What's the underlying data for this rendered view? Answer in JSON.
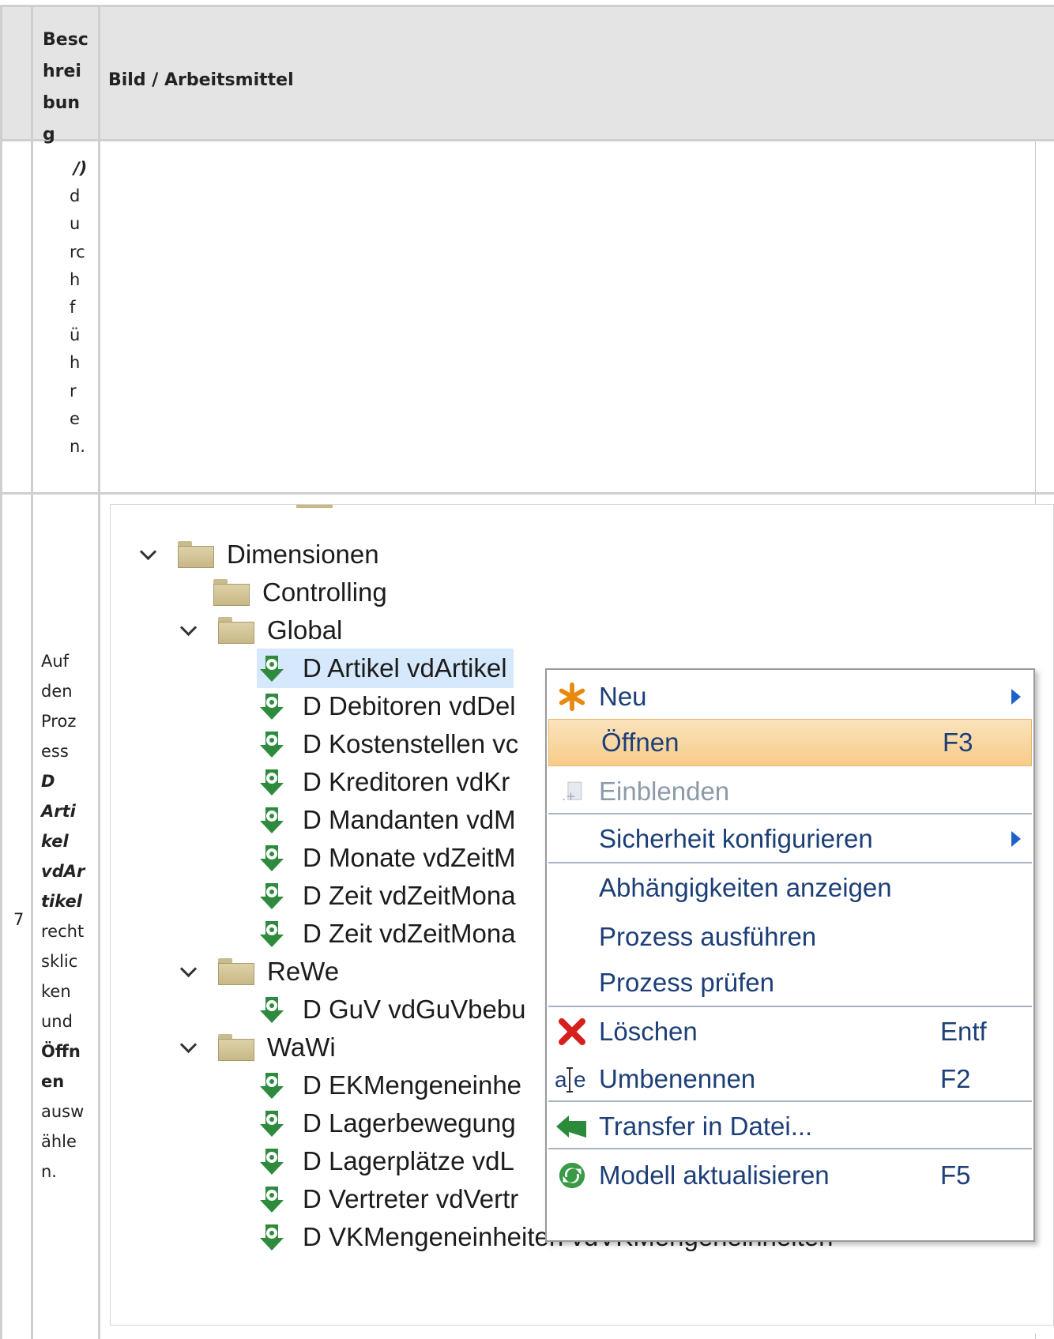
{
  "table": {
    "header": {
      "col_desc": [
        "Besc",
        "hrei",
        "bun",
        "g"
      ],
      "col_bild": "Bild / Arbeitsmittel"
    },
    "row_prev": {
      "desc_chars": [
        "/)",
        "d",
        "u",
        "rc",
        "h",
        "f",
        "ü",
        "h",
        "r",
        "e",
        "n."
      ]
    },
    "row7": {
      "number": "7",
      "desc_lines": [
        {
          "t": "Auf",
          "s": "n"
        },
        {
          "t": "den",
          "s": "n"
        },
        {
          "t": "Proz",
          "s": "n"
        },
        {
          "t": "ess",
          "s": "n"
        },
        {
          "t": "D",
          "s": "bi"
        },
        {
          "t": "Arti",
          "s": "bi"
        },
        {
          "t": "kel",
          "s": "bi"
        },
        {
          "t": "vdAr",
          "s": "bi"
        },
        {
          "t": "tikel",
          "s": "bi"
        },
        {
          "t": "recht",
          "s": "n"
        },
        {
          "t": "sklic",
          "s": "n"
        },
        {
          "t": "ken",
          "s": "n"
        },
        {
          "t": "und",
          "s": "n"
        },
        {
          "t": "Öffn",
          "s": "b"
        },
        {
          "t": "en",
          "s": "b"
        },
        {
          "t": "ausw",
          "s": "n"
        },
        {
          "t": "ähle",
          "s": "n"
        },
        {
          "t": "n.",
          "s": "n"
        }
      ]
    }
  },
  "tree": {
    "items": [
      {
        "label": "Dimensionen",
        "kind": "folder",
        "expanded": true
      },
      {
        "label": "Controlling",
        "kind": "folder",
        "expanded": false
      },
      {
        "label": "Global",
        "kind": "folder",
        "expanded": true
      },
      {
        "label": "D Artikel vdArtikel",
        "kind": "process",
        "selected": true
      },
      {
        "label": "D Debitoren vdDel",
        "kind": "process"
      },
      {
        "label": "D Kostenstellen vc",
        "kind": "process"
      },
      {
        "label": "D Kreditoren vdKr",
        "kind": "process"
      },
      {
        "label": "D Mandanten vdM",
        "kind": "process"
      },
      {
        "label": "D Monate vdZeitM",
        "kind": "process"
      },
      {
        "label": "D Zeit vdZeitMona",
        "kind": "process"
      },
      {
        "label": "D Zeit vdZeitMona",
        "kind": "process"
      },
      {
        "label": "ReWe",
        "kind": "folder",
        "expanded": true
      },
      {
        "label": "D GuV vdGuVbebu",
        "kind": "process"
      },
      {
        "label": "WaWi",
        "kind": "folder",
        "expanded": true
      },
      {
        "label": "D EKMengeneinhe",
        "kind": "process"
      },
      {
        "label": "D Lagerbewegung",
        "kind": "process"
      },
      {
        "label": "D Lagerplätze vdL",
        "kind": "process"
      },
      {
        "label": "D Vertreter vdVertr",
        "kind": "process"
      },
      {
        "label": "D VKMengeneinheiten vdVKMengeneinheiten",
        "kind": "process"
      }
    ]
  },
  "context_menu": {
    "items": [
      {
        "label": "Neu",
        "shortcut": "",
        "icon": "asterisk-icon",
        "submenu": true
      },
      {
        "label": "Öffnen",
        "shortcut": "F3",
        "icon": "",
        "highlighted": true
      },
      {
        "label": "Einblenden",
        "shortcut": "",
        "icon": "show-icon",
        "disabled": true
      },
      {
        "label": "Sicherheit konfigurieren",
        "shortcut": "",
        "icon": "",
        "submenu": true
      },
      {
        "label": "Abhängigkeiten anzeigen",
        "shortcut": "",
        "icon": ""
      },
      {
        "label": "Prozess ausführen",
        "shortcut": "",
        "icon": ""
      },
      {
        "label": "Prozess prüfen",
        "shortcut": "",
        "icon": ""
      },
      {
        "label": "Löschen",
        "shortcut": "Entf",
        "icon": "delete-x-icon"
      },
      {
        "label": "Umbenennen",
        "shortcut": "F2",
        "icon": "rename-icon"
      },
      {
        "label": "Transfer in Datei...",
        "shortcut": "",
        "icon": "transfer-arrow-icon"
      },
      {
        "label": "Modell aktualisieren",
        "shortcut": "F5",
        "icon": "refresh-icon"
      }
    ]
  }
}
